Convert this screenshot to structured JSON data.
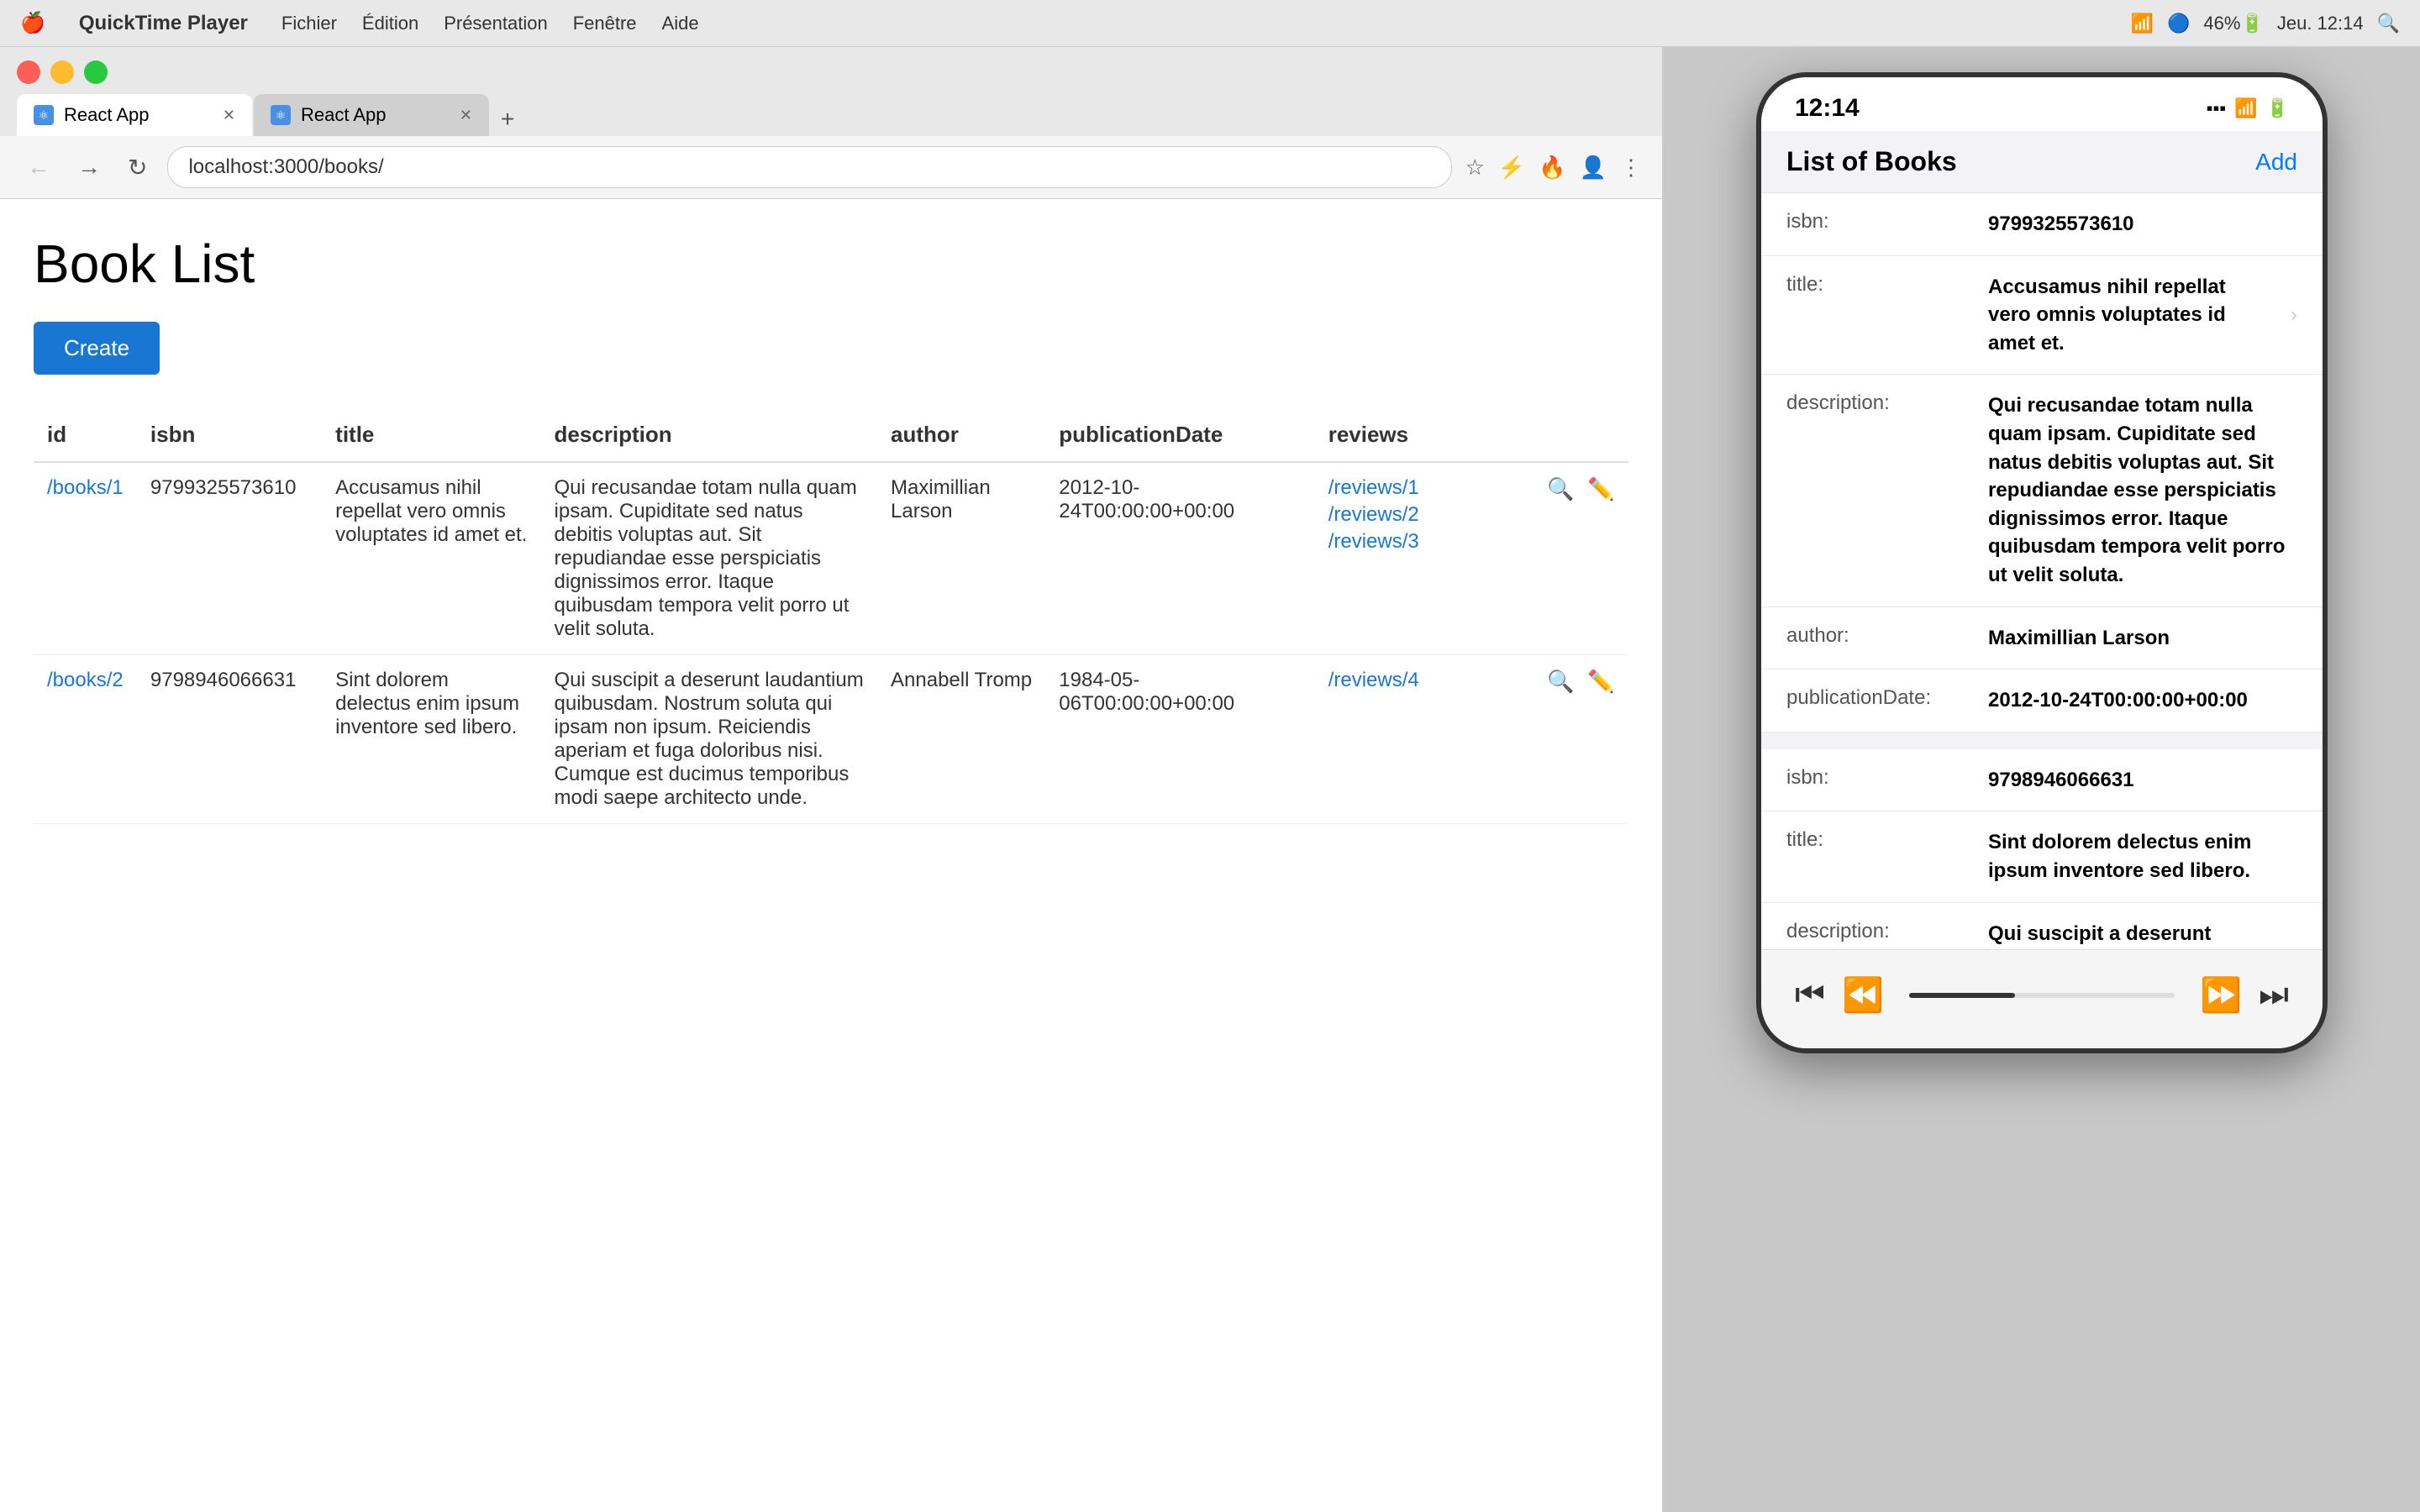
{
  "os": {
    "menubar": {
      "apple": "🍎",
      "app_name": "QuickTime Player",
      "menus": [
        "Fichier",
        "Édition",
        "Présentation",
        "Fenêtre",
        "Aide"
      ],
      "time": "Jeu. 12:14",
      "battery": "46%"
    }
  },
  "browser": {
    "tabs": [
      {
        "label": "React App",
        "active": true,
        "favicon": "⚛"
      },
      {
        "label": "React App",
        "active": false,
        "favicon": "⚛"
      }
    ],
    "address": "localhost:3000/books/",
    "page": {
      "title": "Book List",
      "create_button": "Create",
      "table": {
        "headers": [
          "id",
          "isbn",
          "title",
          "description",
          "author",
          "publicationDate",
          "reviews"
        ],
        "rows": [
          {
            "id": "/books/1",
            "isbn": "9799325573610",
            "title": "Accusamus nihil repellat vero omnis voluptates id amet et.",
            "description": "Qui recusandae totam nulla quam ipsam. Cupiditate sed natus debitis voluptas aut. Sit repudiandae esse perspiciatis dignissimos error. Itaque quibusdam tempora velit porro ut velit soluta.",
            "author": "Maximillian Larson",
            "publicationDate": "2012-10-24T00:00:00+00:00",
            "reviews": [
              "/reviews/1",
              "/reviews/2",
              "/reviews/3"
            ]
          },
          {
            "id": "/books/2",
            "isbn": "9798946066631",
            "title": "Sint dolorem delectus enim ipsum inventore sed libero.",
            "description": "Qui suscipit a deserunt laudantium quibusdam. Nostrum soluta qui ipsam non ipsum. Reiciendis aperiam et fuga doloribus nisi. Cumque est ducimus temporibus modi saepe architecto unde.",
            "author": "Annabell Tromp",
            "publicationDate": "1984-05-06T00:00:00+00:00",
            "reviews": [
              "/reviews/4"
            ]
          }
        ]
      }
    }
  },
  "phone": {
    "status_bar": {
      "time": "12:14",
      "wifi": "wifi",
      "battery": "battery"
    },
    "header": {
      "title": "List of Books",
      "add_button": "Add"
    },
    "book1": {
      "isbn_label": "isbn:",
      "isbn_value": "9799325573610",
      "title_label": "title:",
      "title_value": "Accusamus nihil repellat vero omnis voluptates id amet et.",
      "description_label": "description:",
      "description_value": "Qui recusandae totam nulla quam ipsam. Cupiditate sed natus debitis voluptas aut. Sit repudiandae esse perspiciatis dignissimos error. Itaque quibusdam tempora velit porro ut velit soluta.",
      "author_label": "author:",
      "author_value": "Maximillian Larson",
      "publication_date_label": "publicationDate:",
      "publication_date_value": "2012-10-24T00:00:00+00:00"
    },
    "book2": {
      "isbn_label": "isbn:",
      "isbn_value": "9798946066631",
      "title_label": "title:",
      "title_value": "Sint dolorem delectus enim ipsum inventore sed libero.",
      "description_label": "description:",
      "description_value": "Qui suscipit a deserunt laudantium quibusdam."
    },
    "controls": {
      "skip_back": "⏮",
      "back": "⏪",
      "forward": "⏩",
      "skip_forward": "⏭"
    }
  }
}
